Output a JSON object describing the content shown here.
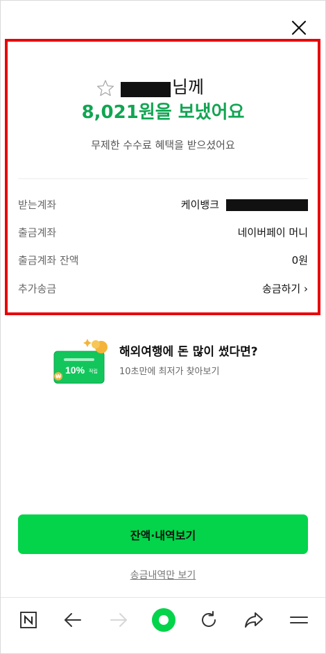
{
  "header": {
    "close_icon": "close-icon"
  },
  "result": {
    "name_suffix": "님께",
    "amount_sentence": "8,021원을 보냈어요",
    "subtitle": "무제한 수수료 혜택을 받으셨어요"
  },
  "details": [
    {
      "label": "받는계좌",
      "bank": "케이뱅크"
    },
    {
      "label": "출금계좌",
      "value": "네이버페이 머니"
    },
    {
      "label": "출금계좌 잔액",
      "value": "0원"
    },
    {
      "label": "추가송금",
      "value": "송금하기 ›"
    }
  ],
  "promo": {
    "title": "해외여행에 돈 많이 썼다면?",
    "subtitle": "10초만에 최저가 찾아보기",
    "image_label": "10%",
    "image_label_sub": "적립"
  },
  "actions": {
    "primary_label": "잔액·내역보기",
    "secondary_label": "송금내역만 보기"
  },
  "bottom_nav": {
    "items": [
      "naver-home-icon",
      "back-arrow-icon",
      "forward-arrow-icon",
      "green-dot-home-icon",
      "refresh-icon",
      "share-icon",
      "menu-icon"
    ]
  },
  "colors": {
    "accent_green": "#03d44a",
    "amount_green": "#11a552",
    "highlight_red": "#e8000a"
  }
}
